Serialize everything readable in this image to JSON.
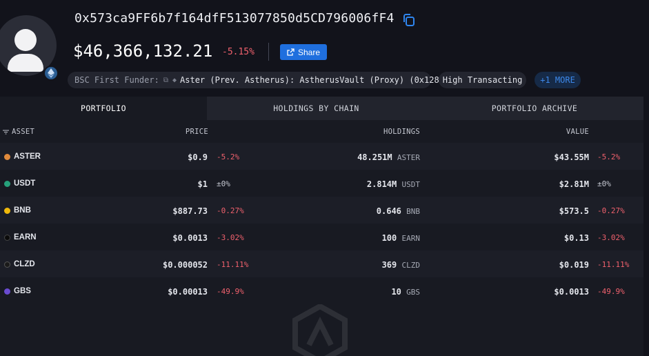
{
  "header": {
    "address": "0x573ca9FF6b7f164dfF513077850d5CD796006fF4",
    "balance": "$46,366,132.21",
    "balance_change": "-5.15%",
    "share_label": "Share"
  },
  "tags": {
    "funder_label": "BSC First Funder:",
    "funder_value": "Aster (Prev. Astherus): AstherusVault (Proxy) (0x128)",
    "high_transacting": "High Transacting",
    "more": "+1 MORE"
  },
  "tabs": [
    "PORTFOLIO",
    "HOLDINGS BY CHAIN",
    "PORTFOLIO ARCHIVE"
  ],
  "columns": {
    "asset": "ASSET",
    "price": "PRICE",
    "holdings": "HOLDINGS",
    "value": "VALUE"
  },
  "rows": [
    {
      "token": "ASTER",
      "price": "$0.9",
      "price_change": "-5.2%",
      "amount": "48.251M",
      "unit": "ASTER",
      "value": "$43.55M",
      "value_change": "-5.2%",
      "color": "#e08a3c"
    },
    {
      "token": "USDT",
      "price": "$1",
      "price_change": "±0%",
      "amount": "2.814M",
      "unit": "USDT",
      "value": "$2.81M",
      "value_change": "±0%",
      "color": "#26a17b"
    },
    {
      "token": "BNB",
      "price": "$887.73",
      "price_change": "-0.27%",
      "amount": "0.646",
      "unit": "BNB",
      "value": "$573.5",
      "value_change": "-0.27%",
      "color": "#f0b90b"
    },
    {
      "token": "EARN",
      "price": "$0.0013",
      "price_change": "-3.02%",
      "amount": "100",
      "unit": "EARN",
      "value": "$0.13",
      "value_change": "-3.02%",
      "color": "#111111"
    },
    {
      "token": "CLZD",
      "price": "$0.000052",
      "price_change": "-11.11%",
      "amount": "369",
      "unit": "CLZD",
      "value": "$0.019",
      "value_change": "-11.11%",
      "color": "#1a1a1a"
    },
    {
      "token": "GBS",
      "price": "$0.00013",
      "price_change": "-49.9%",
      "amount": "10",
      "unit": "GBS",
      "value": "$0.0013",
      "value_change": "-49.9%",
      "color": "#6a4bd0"
    }
  ]
}
